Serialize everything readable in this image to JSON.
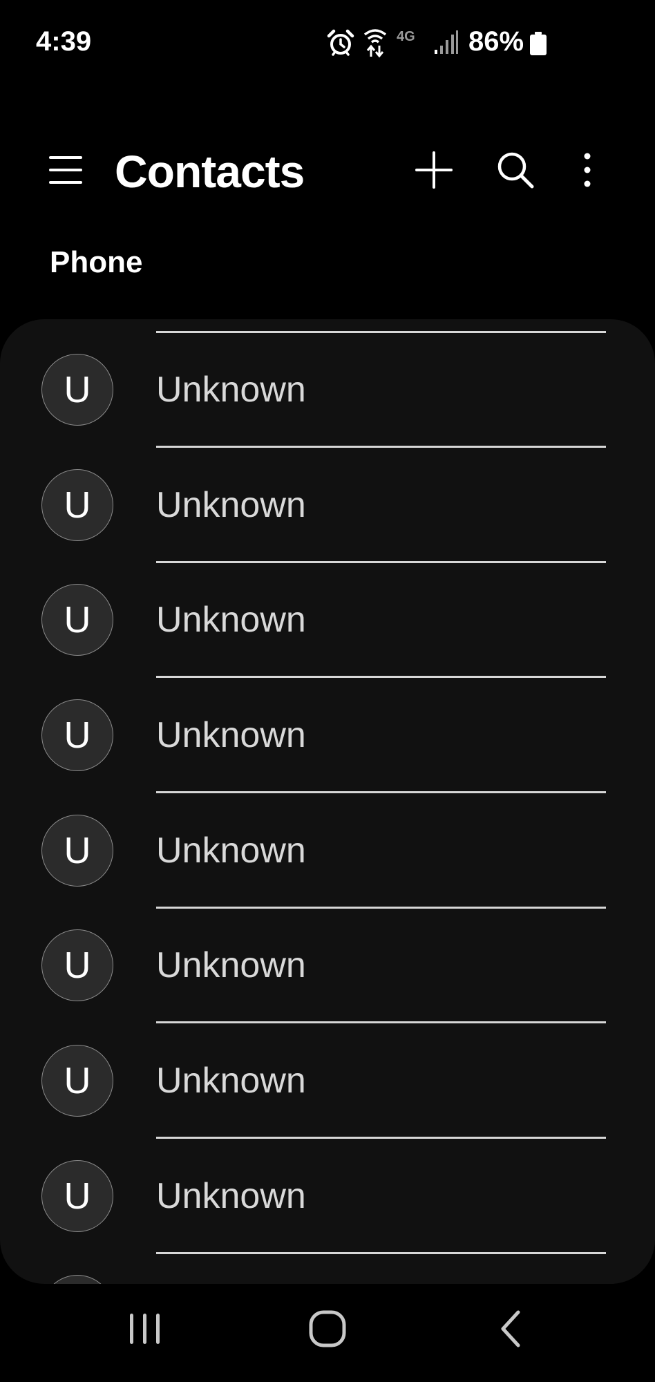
{
  "status_bar": {
    "time": "4:39",
    "network_label": "4G",
    "battery_percent": "86%",
    "icons": [
      "alarm-icon",
      "wifi-calling-icon",
      "4g-lte-icon",
      "signal-icon",
      "battery-icon"
    ]
  },
  "app_bar": {
    "title": "Contacts",
    "icons": [
      "menu-icon",
      "add-icon",
      "search-icon",
      "more-vertical-icon"
    ]
  },
  "section": {
    "label": "Phone"
  },
  "contacts": [
    {
      "initial": "U",
      "name": "Unknown"
    },
    {
      "initial": "U",
      "name": "Unknown"
    },
    {
      "initial": "U",
      "name": "Unknown"
    },
    {
      "initial": "U",
      "name": "Unknown"
    },
    {
      "initial": "U",
      "name": "Unknown"
    },
    {
      "initial": "U",
      "name": "Unknown"
    },
    {
      "initial": "U",
      "name": "Unknown"
    },
    {
      "initial": "U",
      "name": "Unknown"
    },
    {
      "initial": "",
      "name": ""
    }
  ],
  "nav_bar": {
    "icons": [
      "recent-apps-icon",
      "home-icon",
      "back-icon"
    ]
  },
  "colors": {
    "background": "#000000",
    "card": "#111111",
    "divider": "#d7d7d7",
    "avatar_fill": "#2b2b2b",
    "name_text": "#d9d9d9"
  }
}
